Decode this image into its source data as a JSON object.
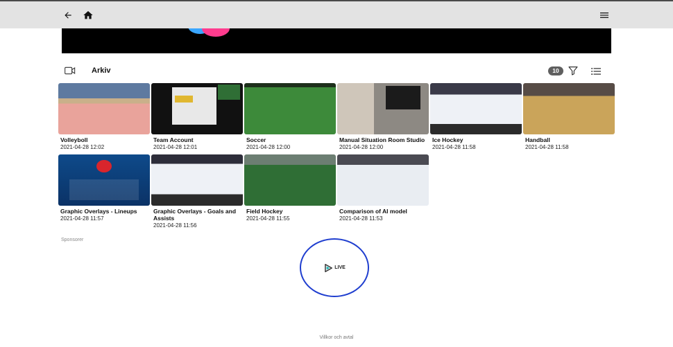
{
  "header": {
    "back_icon": "arrow-left-icon",
    "home_icon": "home-icon",
    "menu_icon": "hamburger-menu-icon"
  },
  "archive": {
    "title": "Arkiv",
    "count": "10",
    "video_icon": "video-camera-icon",
    "filter_icon": "filter-icon",
    "list_icon": "list-view-icon"
  },
  "videos": [
    {
      "title": "Volleyboll",
      "date": "2021-04-28 12:02"
    },
    {
      "title": "Team Account",
      "date": "2021-04-28 12:01"
    },
    {
      "title": "Soccer",
      "date": "2021-04-28 12:00"
    },
    {
      "title": "Manual Situation Room Studio",
      "date": "2021-04-28 12:00"
    },
    {
      "title": "Ice Hockey",
      "date": "2021-04-28 11:58"
    },
    {
      "title": "Handball",
      "date": "2021-04-28 11:58"
    },
    {
      "title": "Graphic Overlays - Lineups",
      "date": "2021-04-28 11:57"
    },
    {
      "title": "Graphic Overlays - Goals and Assists",
      "date": "2021-04-28 11:56"
    },
    {
      "title": "Field Hockey",
      "date": "2021-04-28 11:55"
    },
    {
      "title": "Comparison of AI model",
      "date": "2021-04-28 11:53"
    }
  ],
  "sponsors": {
    "label": "Sponsorer",
    "logo_text": "LIVE"
  },
  "footer": {
    "terms_link": "Villkor och avtal"
  },
  "colors": {
    "topbar": "#e3e3e3",
    "badge": "#5f5f5f",
    "sponsor_ring": "#1f3ecf"
  }
}
